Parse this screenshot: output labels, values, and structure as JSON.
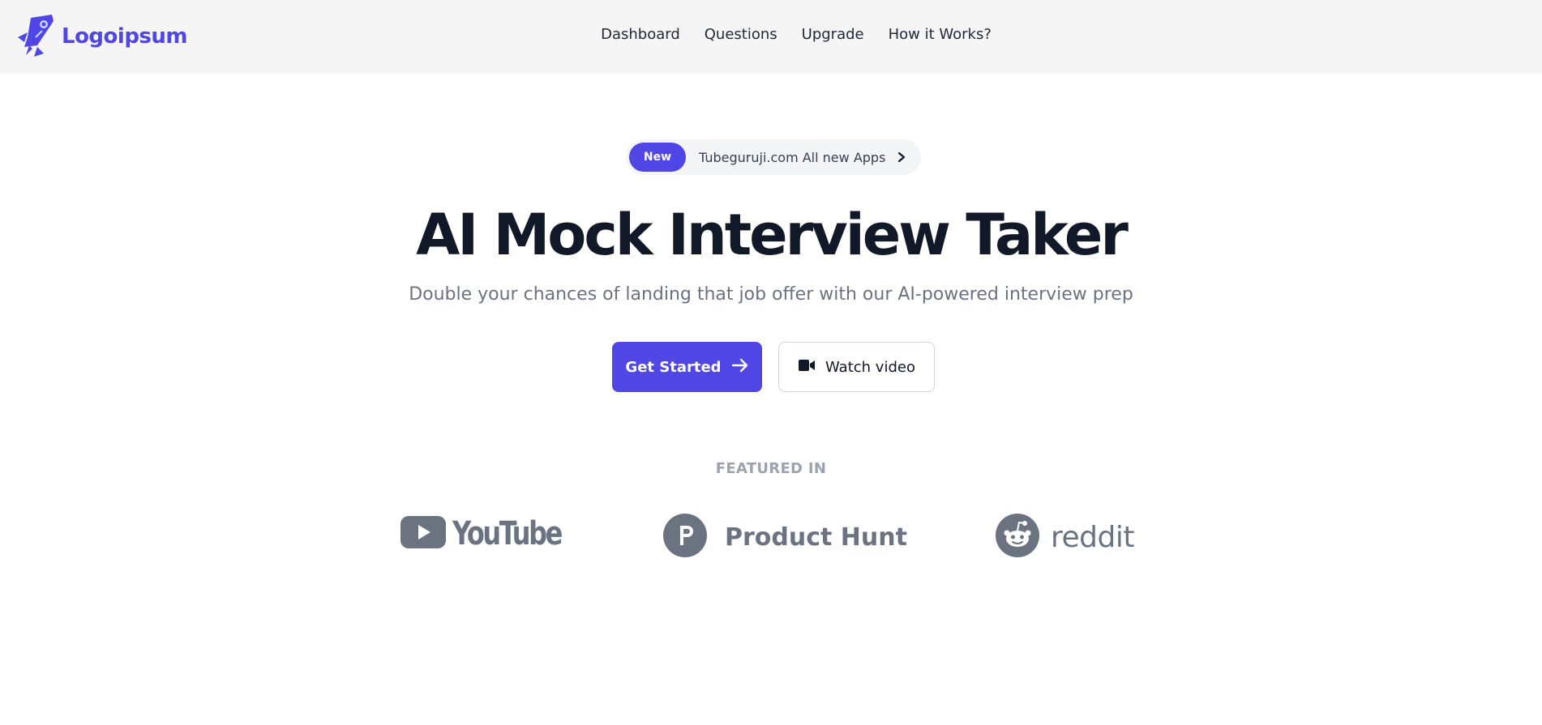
{
  "header": {
    "logo_text": "Logoipsum",
    "nav": [
      "Dashboard",
      "Questions",
      "Upgrade",
      "How it Works?"
    ]
  },
  "announcement": {
    "badge": "New",
    "text": "Tubeguruji.com All new Apps"
  },
  "hero": {
    "title": "AI Mock Interview Taker",
    "subtitle": "Double your chances of landing that job offer with our AI-powered interview prep",
    "primary_button": "Get Started",
    "secondary_button": "Watch video"
  },
  "featured": {
    "label": "FEATURED IN",
    "brands": [
      "YouTube",
      "Product Hunt",
      "reddit"
    ]
  },
  "colors": {
    "accent": "#4f46e5",
    "header_bg": "#f5f5f5",
    "muted_logo": "#6b7280"
  },
  "icons": {
    "logo": "rocket-icon",
    "announce_arrow": "chevron-right-icon",
    "primary_button": "arrow-right-icon",
    "secondary_button": "video-camera-icon",
    "youtube": "youtube-icon",
    "product_hunt": "product-hunt-icon",
    "reddit": "reddit-icon"
  }
}
